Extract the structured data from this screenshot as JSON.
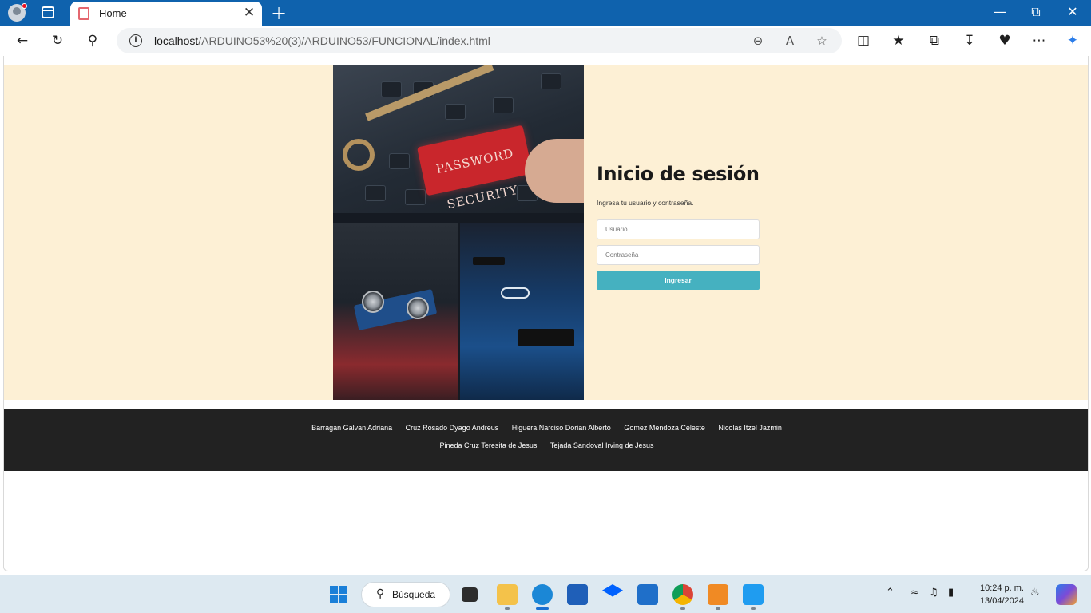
{
  "browser": {
    "tab_title": "Home",
    "tab_close": "✕",
    "new_tab": "+",
    "url_host": "localhost",
    "url_path": "/ARDUINO53%20(3)/ARDUINO53/FUNCIONAL/index.html"
  },
  "image": {
    "key_label_line1": "PASSWORD",
    "key_label_line2": "SECURITY"
  },
  "login": {
    "title": "Inicio de sesión",
    "subtitle": "Ingresa tu usuario y contraseña.",
    "user_placeholder": "Usuario",
    "pass_placeholder": "Contraseña",
    "submit_label": "Ingresar",
    "button_color": "#45b1c0",
    "background_color": "#fdf0d5"
  },
  "footer": {
    "names_row1": [
      "Barragan Galvan Adriana",
      "Cruz Rosado Dyago Andreus",
      "Higuera Narciso Dorian Alberto",
      "Gomez Mendoza Celeste",
      "Nicolas Itzel Jazmin"
    ],
    "names_row2": [
      "Pineda Cruz Teresita de Jesus",
      "Tejada Sandoval Irving de Jesus"
    ]
  },
  "taskbar": {
    "search_label": "Búsqueda",
    "time": "10:24 p. m.",
    "date": "13/04/2024"
  }
}
